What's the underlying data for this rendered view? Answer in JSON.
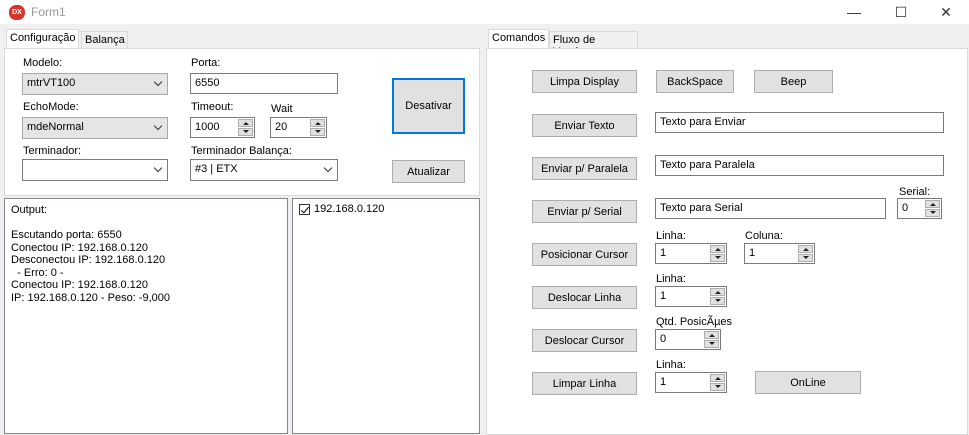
{
  "window": {
    "title": "Form1",
    "icon": "dx-logo-icon",
    "minimize": "—",
    "maximize": "☐",
    "close": "✕"
  },
  "left_tabs": [
    "Configuração",
    "Balança"
  ],
  "right_tabs": [
    "Comandos",
    "Fluxo de Vendas"
  ],
  "config": {
    "modelo_label": "Modelo:",
    "modelo_value": "mtrVT100",
    "porta_label": "Porta:",
    "porta_value": "6550",
    "echomode_label": "EchoMode:",
    "echomode_value": "mdeNormal",
    "timeout_label": "Timeout:",
    "timeout_value": "1000",
    "wait_label": "Wait",
    "wait_value": "20",
    "terminador_label": "Terminador:",
    "terminador_value": "",
    "terminador_balanca_label": "Terminador Balança:",
    "terminador_balanca_value": "#3 | ETX",
    "desativar_label": "Desativar",
    "atualizar_label": "Atualizar"
  },
  "output": {
    "lines": [
      "Output:",
      "",
      "Escutando porta: 6550",
      "Conectou IP: 192.168.0.120",
      "Desconectou IP: 192.168.0.120",
      "  - Erro: 0 -",
      "Conectou IP: 192.168.0.120",
      "IP: 192.168.0.120 - Peso: -9,000"
    ]
  },
  "clients": [
    {
      "label": "192.168.0.120",
      "checked": true
    }
  ],
  "commands": {
    "limpa_display": "Limpa Display",
    "backspace": "BackSpace",
    "beep": "Beep",
    "enviar_texto": "Enviar Texto",
    "enviar_texto_value": "Texto para Enviar",
    "enviar_paralela": "Enviar p/ Paralela",
    "enviar_paralela_value": "Texto para Paralela",
    "enviar_serial": "Enviar p/ Serial",
    "enviar_serial_value": "Texto para Serial",
    "serial_label": "Serial:",
    "serial_value": "0",
    "posicionar_cursor": "Posicionar Cursor",
    "linha_label": "Linha:",
    "coluna_label": "Coluna:",
    "pos_linha_value": "1",
    "pos_coluna_value": "1",
    "deslocar_linha": "Deslocar Linha",
    "desl_linha_value": "1",
    "deslocar_cursor": "Deslocar Cursor",
    "qtd_posicoes_label": "Qtd. PosicÃµes",
    "qtd_posicoes_value": "0",
    "limpar_linha": "Limpar Linha",
    "limpar_linha_value": "1",
    "online": "OnLine"
  }
}
